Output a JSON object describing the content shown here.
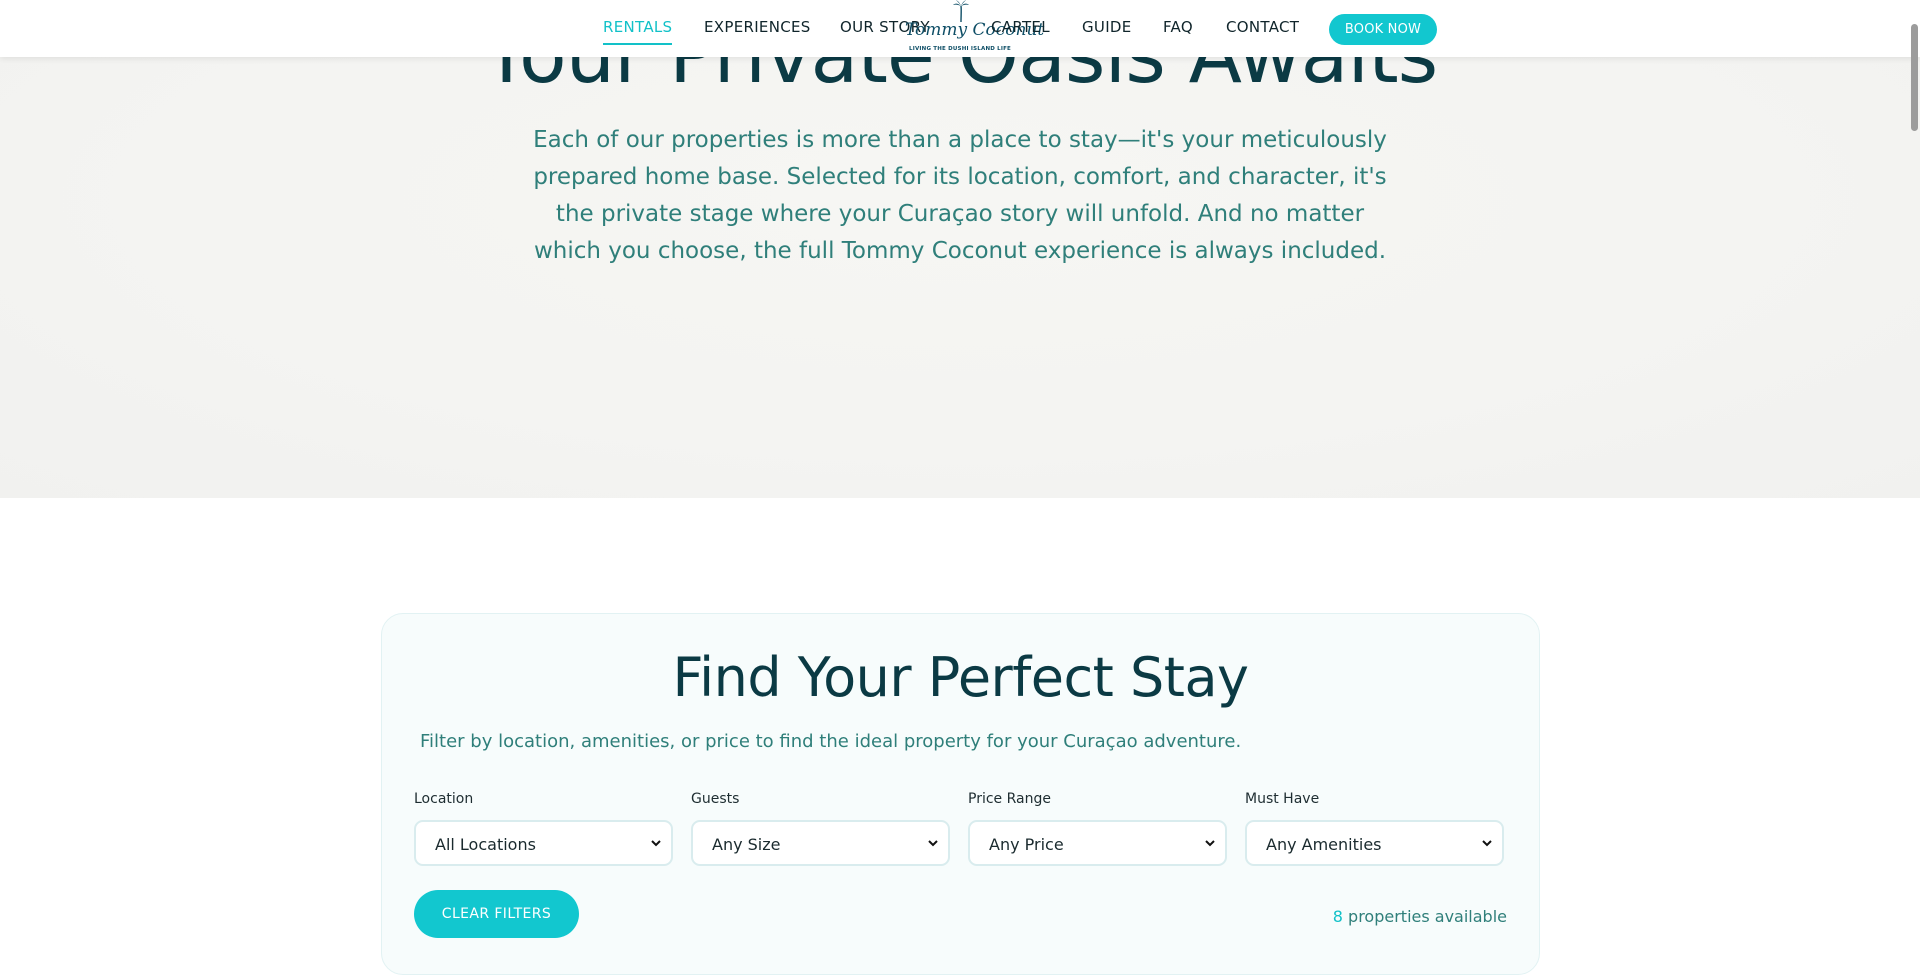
{
  "nav": {
    "links": [
      "RENTALS",
      "EXPERIENCES",
      "OUR STORY",
      "CARTEL",
      "GUIDE",
      "FAQ",
      "CONTACT"
    ],
    "active": "RENTALS",
    "book_label": "BOOK NOW",
    "logo": {
      "name": "Tommy Coconut",
      "tagline": "LIVING THE DUSHI ISLAND LIFE"
    }
  },
  "hero": {
    "title": "Your Private Oasis Awaits",
    "text": "Each of our properties is more than a place to stay—it's your meticulously prepared home base. Selected for its location, comfort, and character, it's the private stage where your Curaçao story will unfold. And no matter which you choose, the full Tommy Coconut experience is always included."
  },
  "filters": {
    "title": "Find Your Perfect Stay",
    "subtitle": "Filter by location, amenities, or price to find the ideal property for your Curaçao adventure.",
    "fields": [
      {
        "label": "Location",
        "value": "All Locations"
      },
      {
        "label": "Guests",
        "value": "Any Size"
      },
      {
        "label": "Price Range",
        "value": "Any Price"
      },
      {
        "label": "Must Have",
        "value": "Any Amenities"
      }
    ],
    "clear_label": "CLEAR FILTERS",
    "count": "8",
    "count_suffix": "properties available"
  },
  "colors": {
    "accent": "#12c7cf",
    "heading": "#0b3a44",
    "body_text": "#2f7f7a"
  }
}
